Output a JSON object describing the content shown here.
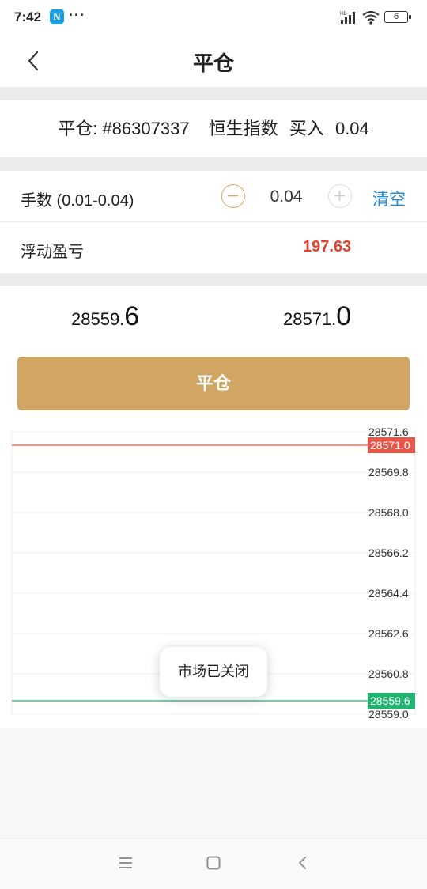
{
  "status_bar": {
    "time": "7:42",
    "app_badge": "N",
    "dots": "···",
    "battery": "6"
  },
  "header": {
    "title": "平仓"
  },
  "order": {
    "prefix": "平仓: #86307337",
    "symbol": "恒生指数",
    "side": "买入",
    "lots": "0.04"
  },
  "lots_row": {
    "label": "手数 (0.01-0.04)",
    "value": "0.04",
    "clear_label": "清空"
  },
  "pnl_row": {
    "label": "浮动盈亏",
    "value": "197.63"
  },
  "prices": {
    "bid_main": "28559.",
    "bid_last": "6",
    "ask_main": "28571.",
    "ask_last": "0"
  },
  "close_button_label": "平仓",
  "toast": "市场已关闭",
  "colors": {
    "accent_gold": "#d1a665",
    "loss_red": "#e0422f",
    "ask_line": "#e8584a",
    "bid_line": "#1fb46f",
    "link_blue": "#2b8ad6"
  },
  "chart_data": {
    "type": "line",
    "y_ticks": [
      "28571.6",
      "28569.8",
      "28568.0",
      "28566.2",
      "28564.4",
      "28562.6",
      "28560.8",
      "28559.0"
    ],
    "y_tick_values": [
      28571.6,
      28569.8,
      28568.0,
      28566.2,
      28564.4,
      28562.6,
      28560.8,
      28559.0
    ],
    "ylim": [
      28559.0,
      28571.6
    ],
    "ask_line": {
      "value": 28571.0,
      "label": "28571.0"
    },
    "bid_line": {
      "value": 28559.6,
      "label": "28559.6"
    },
    "grid": true
  }
}
